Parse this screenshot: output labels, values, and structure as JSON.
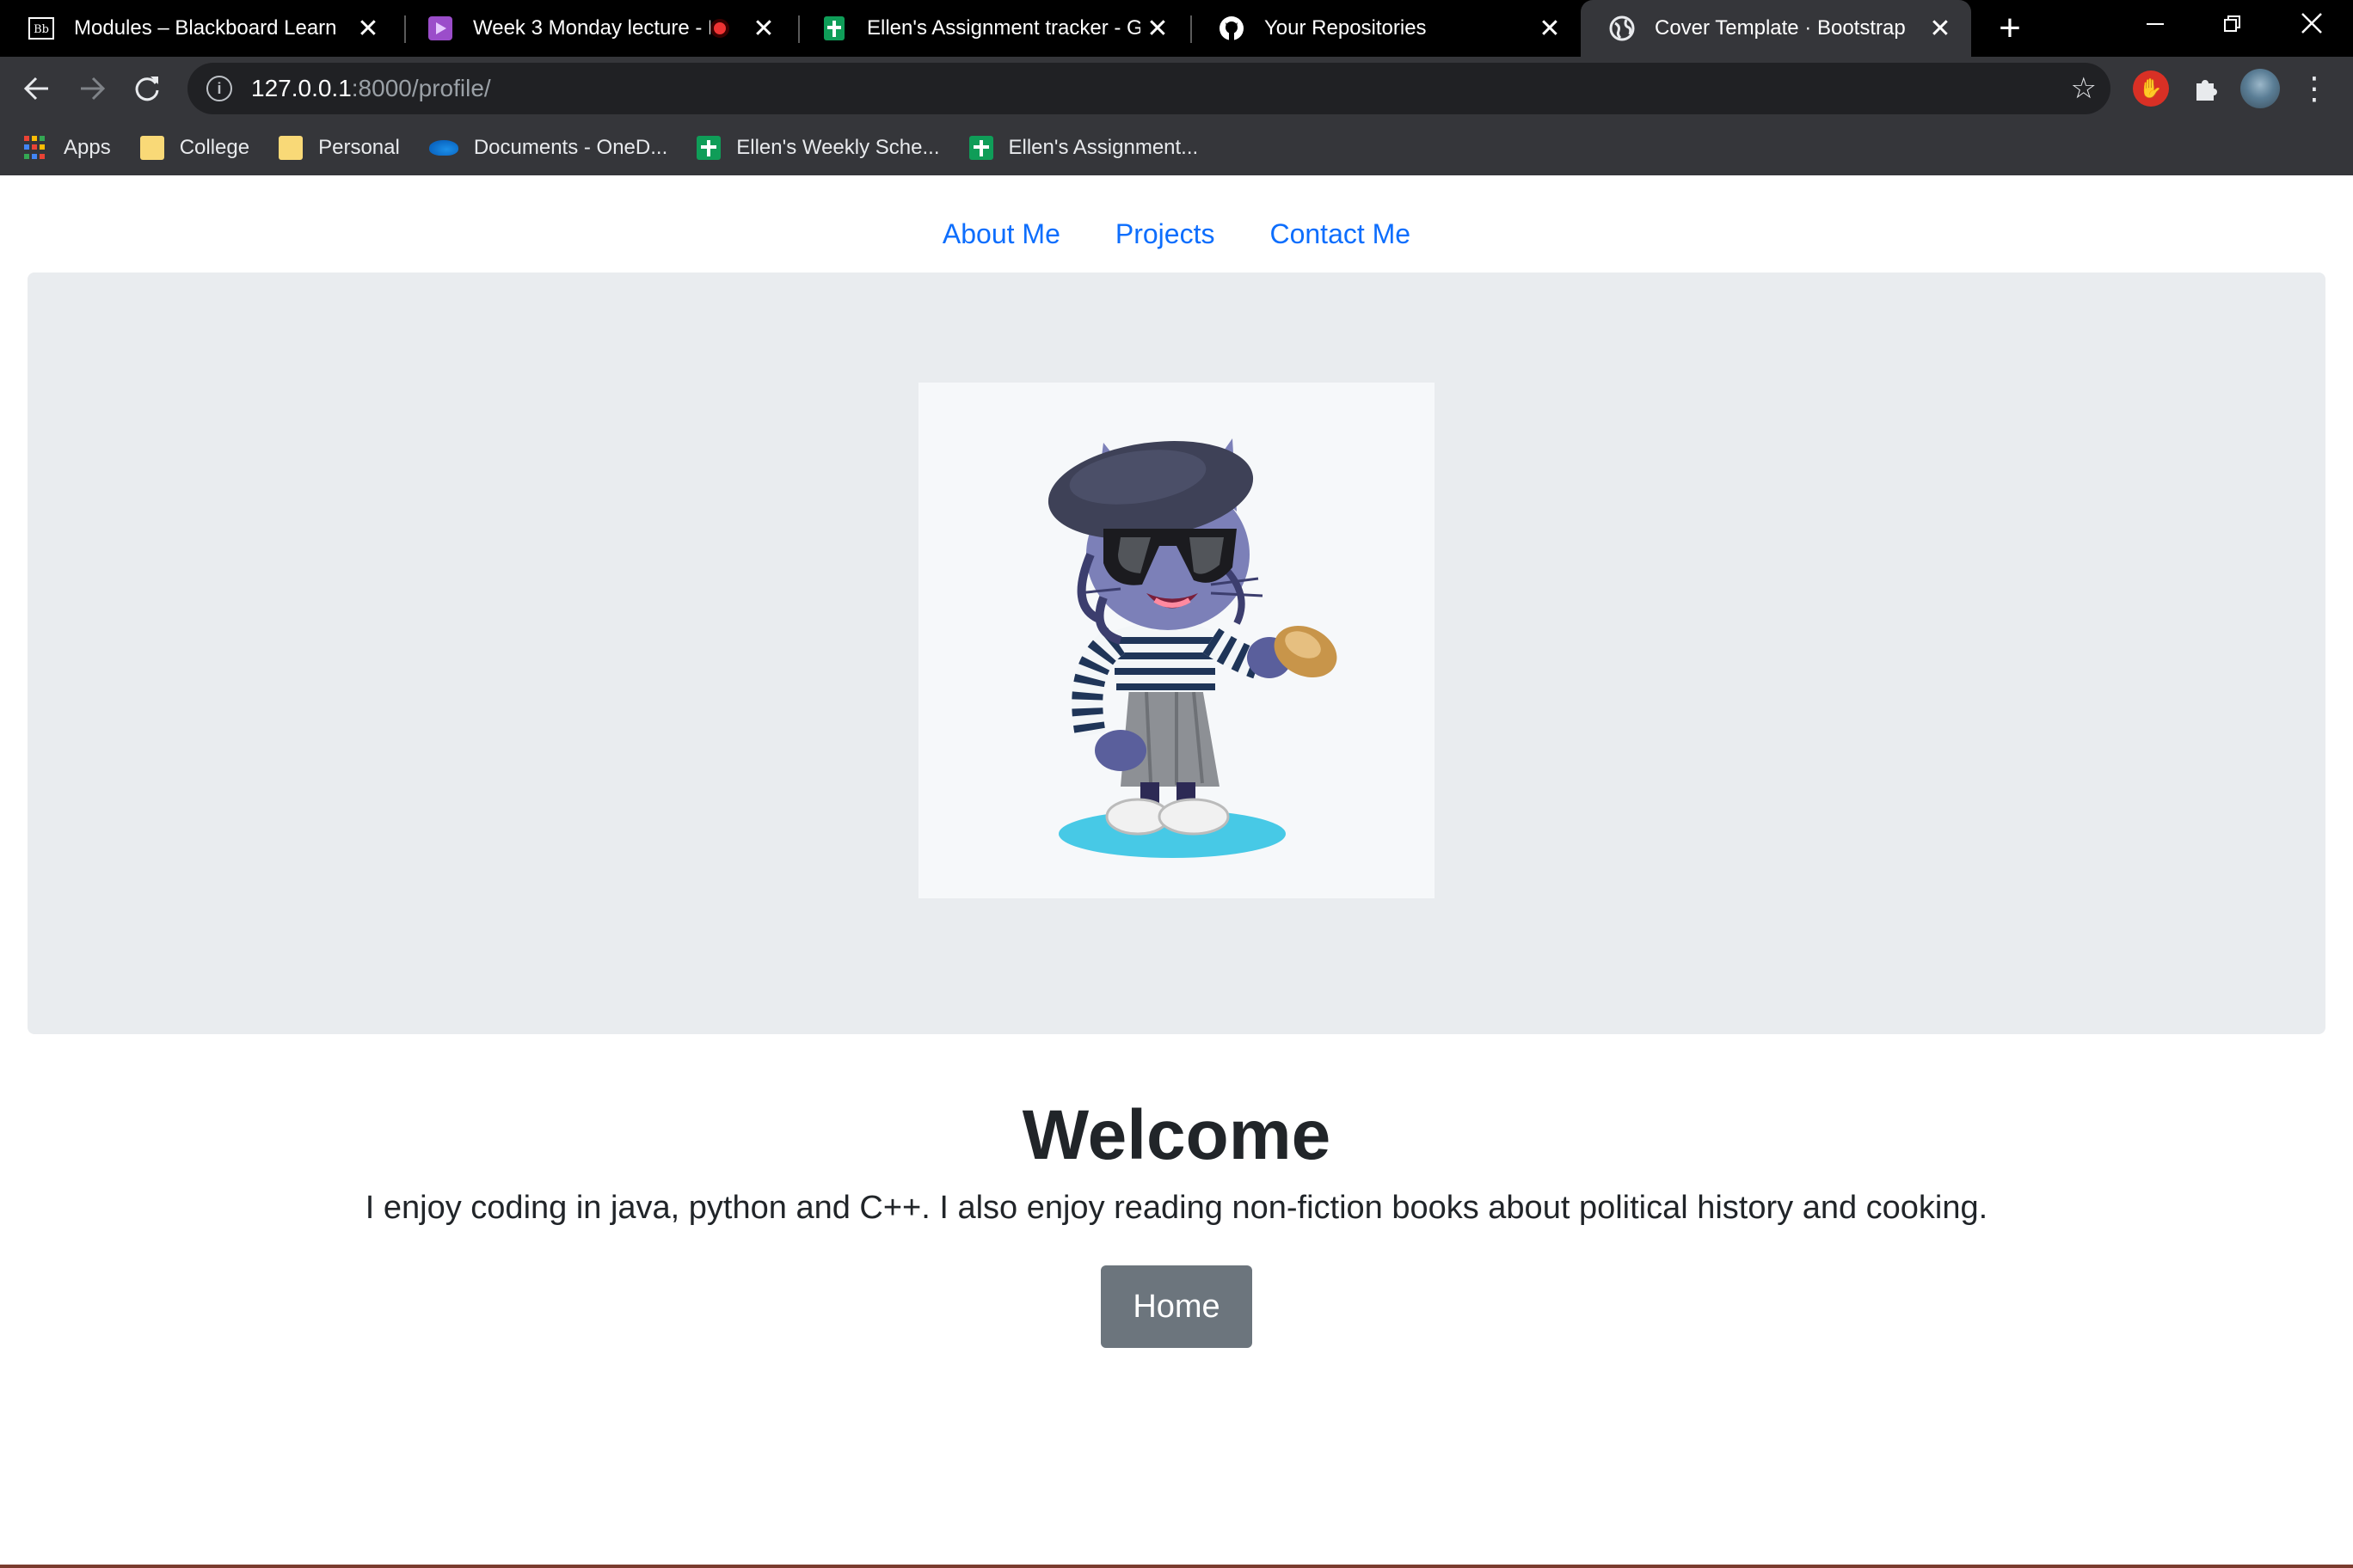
{
  "browser": {
    "tabs": [
      {
        "title": "Modules – Blackboard Learn",
        "icon": "blackboard-icon"
      },
      {
        "title": "Week 3 Monday lecture - E",
        "icon": "video-icon",
        "recording": true
      },
      {
        "title": "Ellen's Assignment tracker - Go",
        "icon": "google-sheets-icon"
      },
      {
        "title": "Your Repositories",
        "icon": "github-icon"
      },
      {
        "title": "Cover Template · Bootstrap",
        "icon": "globe-icon",
        "active": true
      }
    ],
    "new_tab": "+",
    "url_host": "127.0.0.1",
    "url_rest": ":8000/profile/",
    "bookmarks": [
      {
        "label": "Apps",
        "icon": "apps-grid-icon"
      },
      {
        "label": "College",
        "icon": "folder-icon"
      },
      {
        "label": "Personal",
        "icon": "folder-icon"
      },
      {
        "label": "Documents - OneD...",
        "icon": "onedrive-icon"
      },
      {
        "label": "Ellen's Weekly Sche...",
        "icon": "google-sheets-icon"
      },
      {
        "label": "Ellen's Assignment...",
        "icon": "google-sheets-icon"
      }
    ]
  },
  "site": {
    "nav": [
      "About Me",
      "Projects",
      "Contact Me"
    ],
    "heading": "Welcome",
    "lead": "I enjoy coding in java, python and C++. I also enjoy reading non-fiction books about political history and cooking.",
    "button": "Home"
  },
  "colors": {
    "link": "#0d6efd",
    "hero_bg": "#e9ecef",
    "button_bg": "#6c757d",
    "chrome_bg": "#35363a"
  }
}
